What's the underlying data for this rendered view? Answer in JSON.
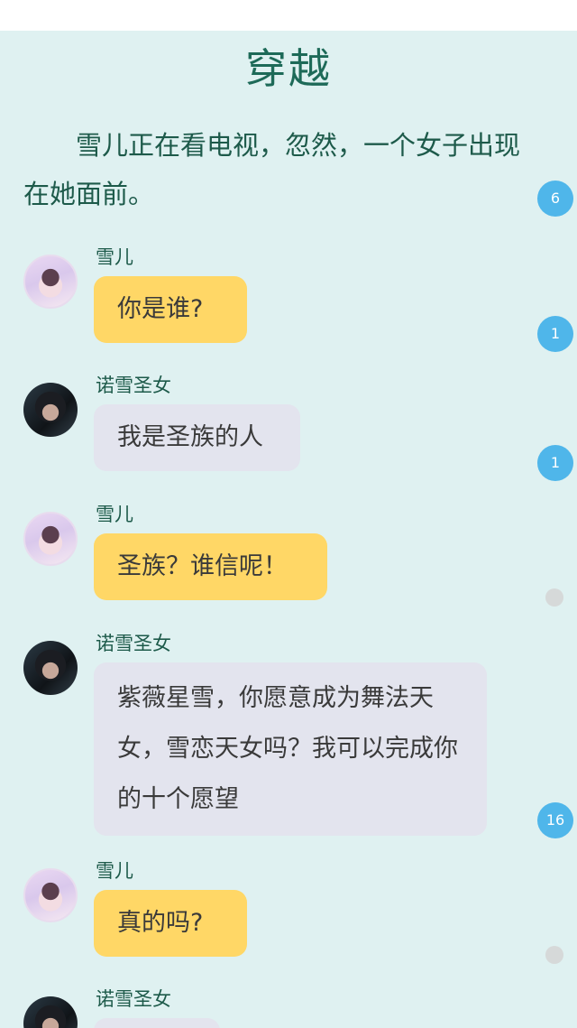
{
  "story": {
    "title": "穿越",
    "intro": "雪儿正在看电视，忽然，一个女子出现在她面前。"
  },
  "messages": [
    {
      "speaker": "雪儿",
      "text": "你是谁?",
      "style": "yellow"
    },
    {
      "speaker": "诺雪圣女",
      "text": "我是圣族的人",
      "style": "grey"
    },
    {
      "speaker": "雪儿",
      "text": "圣族？谁信呢！",
      "style": "yellow"
    },
    {
      "speaker": "诺雪圣女",
      "text": "紫薇星雪，你愿意成为舞法天女，雪恋天女吗？我可以完成你的十个愿望",
      "style": "grey"
    },
    {
      "speaker": "雪儿",
      "text": "真的吗?",
      "style": "yellow"
    },
    {
      "speaker": "诺雪圣女",
      "text": "",
      "style": "grey"
    }
  ],
  "comment_badges": [
    "6",
    "1",
    "1",
    "16"
  ],
  "colors": {
    "background": "#dff1f1",
    "title": "#1d6a58",
    "bubble_yellow": "#ffd766",
    "bubble_grey": "#e3e4ee",
    "badge": "#4fb6ea"
  }
}
